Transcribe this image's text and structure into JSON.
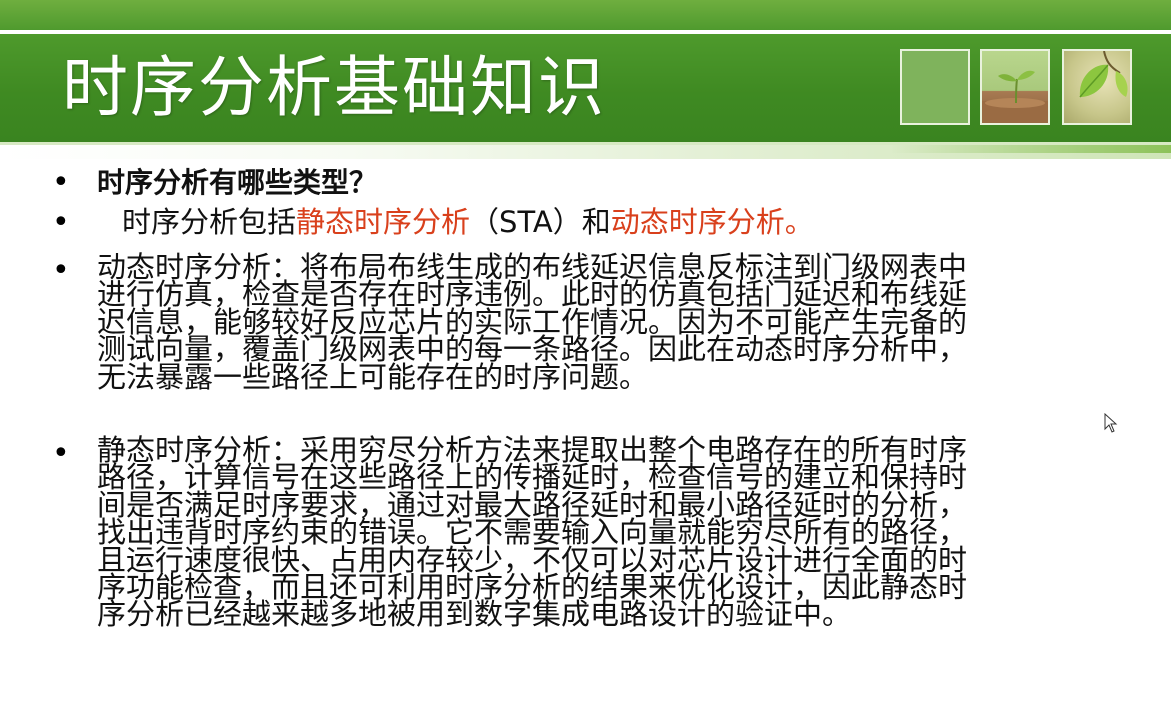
{
  "slide": {
    "title": "时序分析基础知识",
    "question": "时序分析有哪些类型？",
    "types": {
      "prefix": "时序分析包括",
      "static": "静态时序分析",
      "sta": "（STA）和",
      "dynamic": "动态时序分析",
      "suffix": "。"
    },
    "dynamic_lines": [
      "动态时序分析：将布局布线生成的布线延迟信息反标注到门级网表中",
      "进行仿真，检查是否存在时序违例。此时的仿真包括门延迟和布线延",
      "迟信息，能够较好反应芯片的实际工作情况。因为不可能产生完备的",
      "测试向量，覆盖门级网表中的每一条路径。因此在动态时序分析中，",
      "无法暴露一些路径上可能存在的时序问题。"
    ],
    "static_lines": [
      "静态时序分析：采用穷尽分析方法来提取出整个电路存在的所有时序",
      "路径，计算信号在这些路径上的传播延时，检查信号的建立和保持时",
      "间是否满足时序要求，通过对最大路径延时和最小路径延时的分析，",
      "找出违背时序约束的错误。它不需要输入向量就能穷尽所有的路径，",
      "且运行速度很快、占用内存较少，不仅可以对芯片设计进行全面的时",
      "序功能检查，而且还可利用时序分析的结果来优化设计，因此静态时",
      "序分析已经越来越多地被用到数字集成电路设计的验证中。"
    ],
    "bullet_glyph": "•",
    "colors": {
      "header_green": "#3f8a22",
      "highlight_red": "#d9401c",
      "text": "#111111"
    },
    "icons": [
      "bullet-icon",
      "mouse-cursor-icon"
    ]
  }
}
